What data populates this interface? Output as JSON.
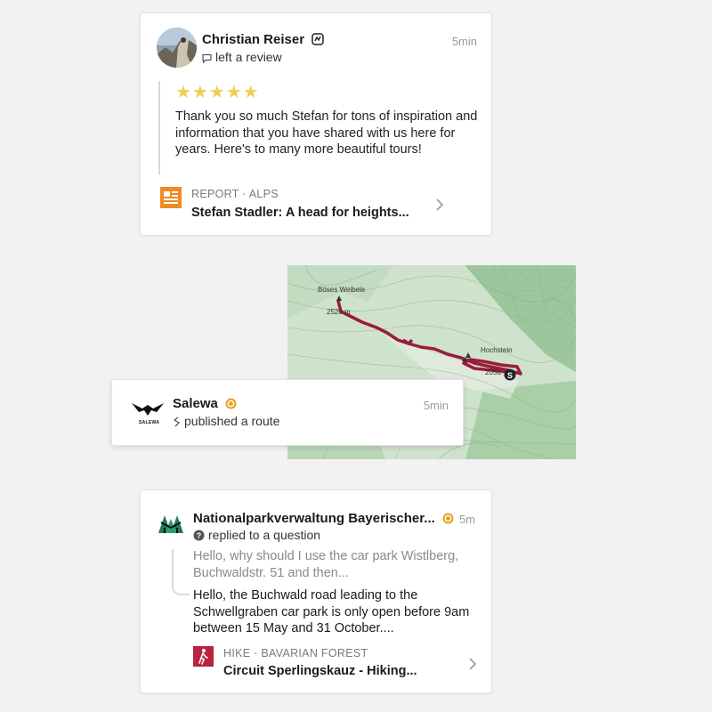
{
  "review_card": {
    "user_name": "Christian Reiser",
    "action": "left a review",
    "time": "5min",
    "rating": "★★★★★",
    "text": "Thank you so much Stefan for tons of inspiration and information that you have shared with us here for years. Here's to many more beautiful tours!",
    "link_tag": "REPORT · ALPS",
    "link_title": "Stefan Stadler: A head for heights..."
  },
  "map": {
    "peak_top": "Böses Weibele",
    "elev_top": "2520 m",
    "peak_right": "Hochstein",
    "elev_right": "2056",
    "route_color": "#9b1c3a"
  },
  "route_card": {
    "user_name": "Salewa",
    "logo_text": "SALEWA",
    "action": "published a route",
    "time": "5min"
  },
  "question_card": {
    "user_name": "Nationalparkverwaltung Bayerischer...",
    "action": "replied to a question",
    "time": "5m",
    "question": "Hello, why should I use the car park Wistlberg, Buchwaldstr. 51 and then...",
    "answer": "Hello, the Buchwald road leading to the Schwellgraben car park is only open before 9am between 15 May and 31 October....",
    "link_tag": "HIKE · BAVARIAN FOREST",
    "link_title": "Circuit Sperlingskauz - Hiking..."
  },
  "colors": {
    "star": "#f3cd55",
    "report_icon": "#f08a24",
    "hike_icon": "#b8243f",
    "verified_badge": "#e5a321"
  }
}
